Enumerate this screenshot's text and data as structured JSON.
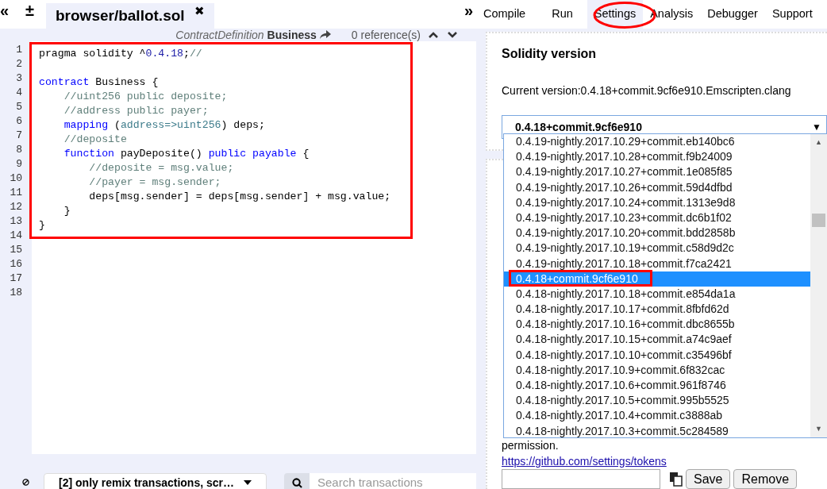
{
  "editor": {
    "collapse_left": "«",
    "add_remove": "±",
    "expand_right": "»",
    "file_tab": {
      "label": "browser/ballot.sol",
      "close": "✖"
    },
    "toolbar": {
      "node_type": "ContractDefinition",
      "node_name": "Business",
      "references": "0 reference(s)"
    },
    "lines": [
      {
        "number": "1",
        "tokens": [
          {
            "kind": "plain",
            "text": "pragma solidity ^"
          },
          {
            "kind": "number",
            "text": "0.4.18"
          },
          {
            "kind": "plain",
            "text": ";"
          },
          {
            "kind": "comment",
            "text": "//"
          }
        ]
      },
      {
        "number": "2"
      },
      {
        "number": "3",
        "tokens": [
          {
            "kind": "keyword",
            "text": "contract"
          },
          {
            "kind": "plain",
            "text": " Business {"
          }
        ]
      },
      {
        "number": "4",
        "tokens": [
          {
            "kind": "comment",
            "text": "    //uint256 public deposite;"
          }
        ]
      },
      {
        "number": "5",
        "tokens": [
          {
            "kind": "comment",
            "text": "    //address public payer;"
          }
        ]
      },
      {
        "number": "6",
        "tokens": [
          {
            "kind": "keyword",
            "text": "    mapping"
          },
          {
            "kind": "plain",
            "text": " ("
          },
          {
            "kind": "type",
            "text": "address=>uint256"
          },
          {
            "kind": "plain",
            "text": ") deps;"
          }
        ]
      },
      {
        "number": "7",
        "tokens": [
          {
            "kind": "comment",
            "text": "    //deposite"
          }
        ]
      },
      {
        "number": "8",
        "tokens": [
          {
            "kind": "keyword",
            "text": "    function"
          },
          {
            "kind": "plain",
            "text": " payDeposite() "
          },
          {
            "kind": "keyword",
            "text": "public payable"
          },
          {
            "kind": "plain",
            "text": " {"
          }
        ]
      },
      {
        "number": "9",
        "tokens": [
          {
            "kind": "comment",
            "text": "        //deposite = msg.value;"
          }
        ]
      },
      {
        "number": "10",
        "tokens": [
          {
            "kind": "comment",
            "text": "        //payer = msg.sender;"
          }
        ]
      },
      {
        "number": "11",
        "tokens": [
          {
            "kind": "plain",
            "text": "        deps[msg.sender] = deps[msg.sender] + msg.value;"
          }
        ]
      },
      {
        "number": "12",
        "tokens": [
          {
            "kind": "plain",
            "text": "    }"
          }
        ]
      },
      {
        "number": "13",
        "tokens": [
          {
            "kind": "plain",
            "text": "}"
          }
        ]
      },
      {
        "number": "14"
      },
      {
        "number": "15"
      },
      {
        "number": "16"
      },
      {
        "number": "17"
      },
      {
        "number": "18"
      }
    ],
    "console": {
      "filter": "[2] only remix transactions, scr…",
      "search_placeholder": "Search transactions"
    }
  },
  "tabs": [
    {
      "label": "Compile",
      "selected": false
    },
    {
      "label": "Run",
      "selected": false
    },
    {
      "label": "Settings",
      "selected": true
    },
    {
      "label": "Analysis",
      "selected": false
    },
    {
      "label": "Debugger",
      "selected": false
    },
    {
      "label": "Support",
      "selected": false
    }
  ],
  "settings": {
    "title": "Solidity version",
    "current_version": "Current version:0.4.18+commit.9cf6e910.Emscripten.clang",
    "select_value": "0.4.18+commit.9cf6e910",
    "select_arrow": "▼",
    "scroll_up": "▲",
    "scroll_down": "▼",
    "options": [
      {
        "label": "0.4.19-nightly.2017.10.29+commit.eb140bc6",
        "selected": false
      },
      {
        "label": "0.4.19-nightly.2017.10.28+commit.f9b24009",
        "selected": false
      },
      {
        "label": "0.4.19-nightly.2017.10.27+commit.1e085f85",
        "selected": false
      },
      {
        "label": "0.4.19-nightly.2017.10.26+commit.59d4dfbd",
        "selected": false
      },
      {
        "label": "0.4.19-nightly.2017.10.24+commit.1313e9d8",
        "selected": false
      },
      {
        "label": "0.4.19-nightly.2017.10.23+commit.dc6b1f02",
        "selected": false
      },
      {
        "label": "0.4.19-nightly.2017.10.20+commit.bdd2858b",
        "selected": false
      },
      {
        "label": "0.4.19-nightly.2017.10.19+commit.c58d9d2c",
        "selected": false
      },
      {
        "label": "0.4.19-nightly.2017.10.18+commit.f7ca2421",
        "selected": false
      },
      {
        "label": "0.4.18+commit.9cf6e910",
        "selected": true
      },
      {
        "label": "0.4.18-nightly.2017.10.18+commit.e854da1a",
        "selected": false
      },
      {
        "label": "0.4.18-nightly.2017.10.17+commit.8fbfd62d",
        "selected": false
      },
      {
        "label": "0.4.18-nightly.2017.10.16+commit.dbc8655b",
        "selected": false
      },
      {
        "label": "0.4.18-nightly.2017.10.15+commit.a74c9aef",
        "selected": false
      },
      {
        "label": "0.4.18-nightly.2017.10.10+commit.c35496bf",
        "selected": false
      },
      {
        "label": "0.4.18-nightly.2017.10.9+commit.6f832cac",
        "selected": false
      },
      {
        "label": "0.4.18-nightly.2017.10.6+commit.961f8746",
        "selected": false
      },
      {
        "label": "0.4.18-nightly.2017.10.5+commit.995b5525",
        "selected": false
      },
      {
        "label": "0.4.18-nightly.2017.10.4+commit.c3888ab",
        "selected": false
      },
      {
        "label": "0.4.18-nightly.2017.10.3+commit.5c284589",
        "selected": false
      }
    ],
    "gist_text": "permission.",
    "gist_link": "https://github.com/settings/tokens",
    "buttons": [
      "Save",
      "Remove"
    ]
  }
}
